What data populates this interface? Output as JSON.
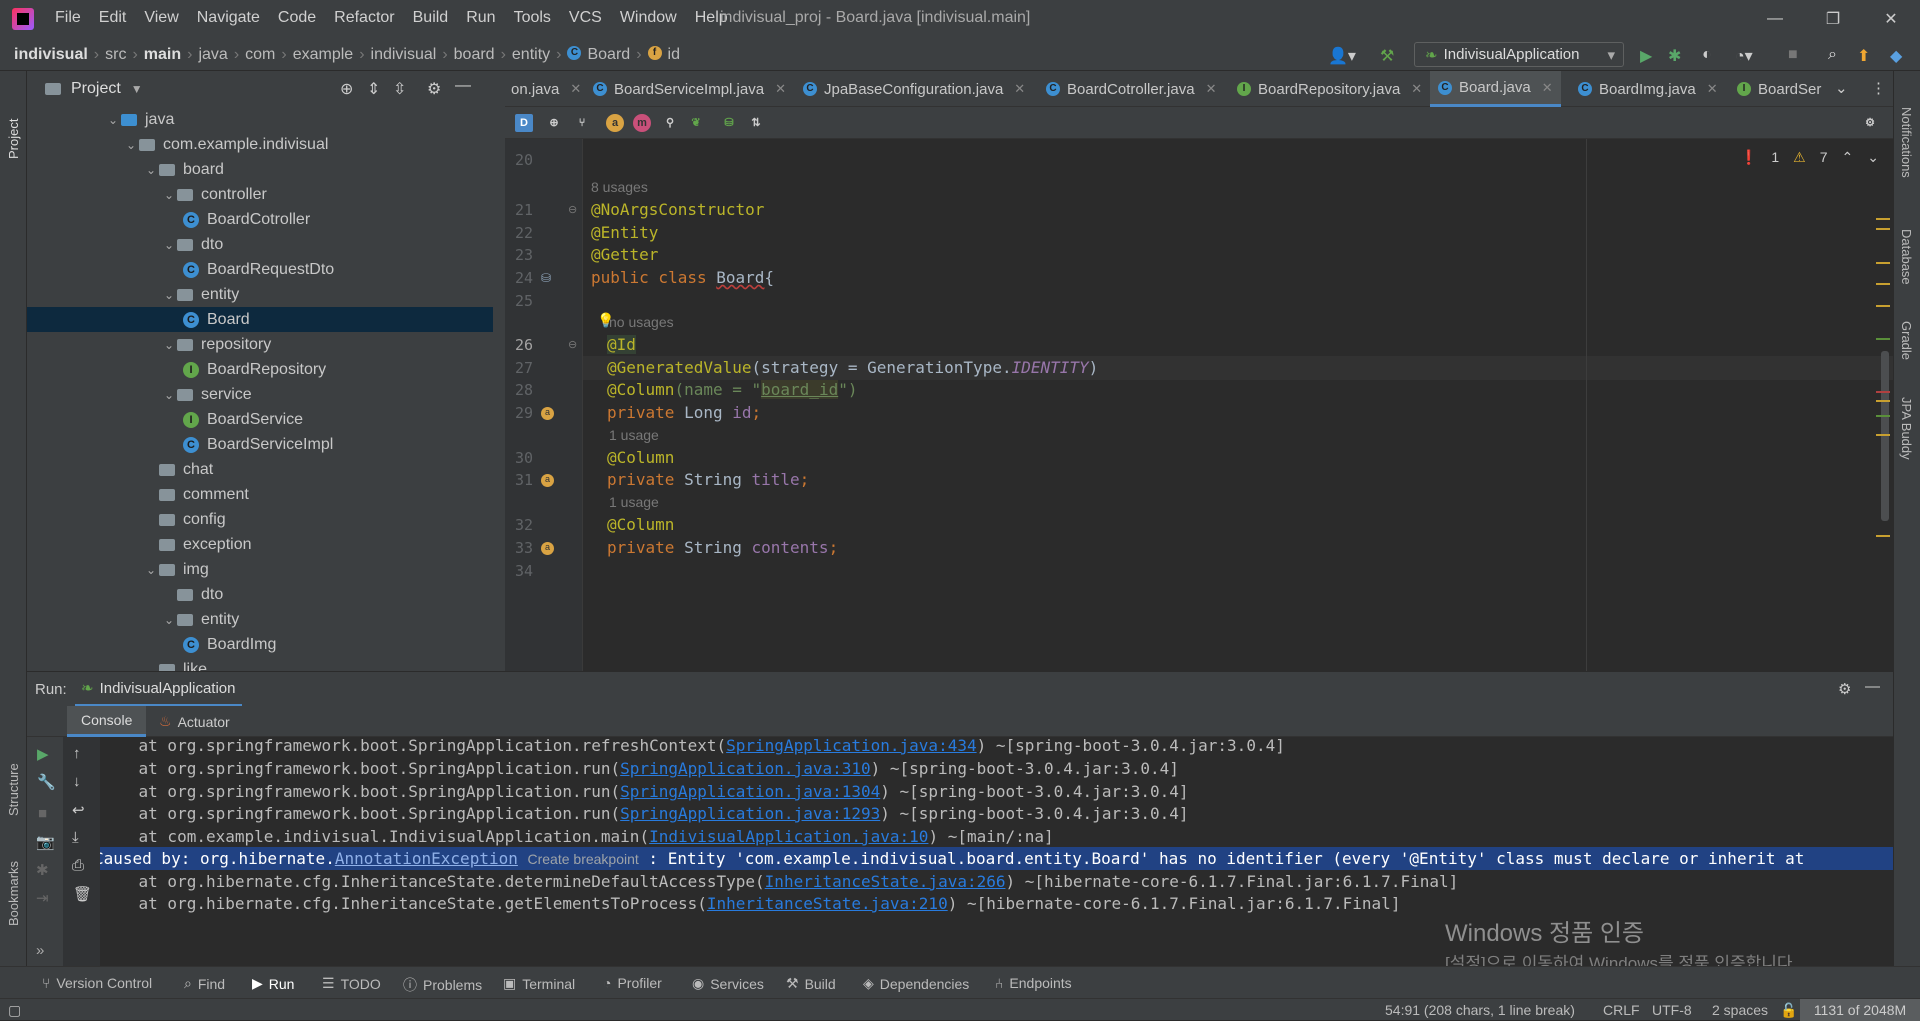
{
  "window": {
    "title": "indivisual_proj - Board.java [indivisual.main]",
    "menu": [
      "File",
      "Edit",
      "View",
      "Navigate",
      "Code",
      "Refactor",
      "Build",
      "Run",
      "Tools",
      "VCS",
      "Window",
      "Help"
    ],
    "controls": [
      "—",
      "❐",
      "✕"
    ]
  },
  "breadcrumbs": [
    "indivisual",
    "src",
    "main",
    "java",
    "com",
    "example",
    "indivisual",
    "board",
    "entity",
    "Board",
    "id"
  ],
  "run_config": "IndivisualApplication",
  "project": {
    "title": "Project",
    "tree": [
      {
        "label": "java",
        "kind": "folder-blue",
        "depth": 0,
        "expanded": true
      },
      {
        "label": "com.example.indivisual",
        "kind": "folder",
        "depth": 1,
        "expanded": true
      },
      {
        "label": "board",
        "kind": "folder",
        "depth": 2,
        "expanded": true
      },
      {
        "label": "controller",
        "kind": "folder",
        "depth": 3,
        "expanded": true
      },
      {
        "label": "BoardCotroller",
        "kind": "class",
        "depth": 4
      },
      {
        "label": "dto",
        "kind": "folder",
        "depth": 3,
        "expanded": true
      },
      {
        "label": "BoardRequestDto",
        "kind": "class",
        "depth": 4
      },
      {
        "label": "entity",
        "kind": "folder",
        "depth": 3,
        "expanded": true
      },
      {
        "label": "Board",
        "kind": "class",
        "depth": 4,
        "selected": true
      },
      {
        "label": "repository",
        "kind": "folder",
        "depth": 3,
        "expanded": true
      },
      {
        "label": "BoardRepository",
        "kind": "interface",
        "depth": 4
      },
      {
        "label": "service",
        "kind": "folder",
        "depth": 3,
        "expanded": true
      },
      {
        "label": "BoardService",
        "kind": "interface",
        "depth": 4
      },
      {
        "label": "BoardServiceImpl",
        "kind": "class",
        "depth": 4
      },
      {
        "label": "chat",
        "kind": "folder",
        "depth": 2
      },
      {
        "label": "comment",
        "kind": "folder",
        "depth": 2
      },
      {
        "label": "config",
        "kind": "folder",
        "depth": 2
      },
      {
        "label": "exception",
        "kind": "folder",
        "depth": 2
      },
      {
        "label": "img",
        "kind": "folder",
        "depth": 2,
        "expanded": true
      },
      {
        "label": "dto",
        "kind": "folder",
        "depth": 3
      },
      {
        "label": "entity",
        "kind": "folder",
        "depth": 3,
        "expanded": true
      },
      {
        "label": "BoardImg",
        "kind": "class",
        "depth": 4
      },
      {
        "label": "like",
        "kind": "folder",
        "depth": 2
      }
    ]
  },
  "editor_tabs": [
    {
      "label": "on.java",
      "icon": "none"
    },
    {
      "label": "BoardServiceImpl.java",
      "icon": "class"
    },
    {
      "label": "JpaBaseConfiguration.java",
      "icon": "class"
    },
    {
      "label": "BoardCotroller.java",
      "icon": "class"
    },
    {
      "label": "BoardRepository.java",
      "icon": "interface"
    },
    {
      "label": "Board.java",
      "icon": "class",
      "active": true
    },
    {
      "label": "BoardImg.java",
      "icon": "class"
    },
    {
      "label": "BoardSer",
      "icon": "interface"
    }
  ],
  "inspections": {
    "errors": "1",
    "warnings": "7"
  },
  "code": {
    "hints": {
      "h1": "8 usages",
      "h2": "no usages",
      "h3": "1 usage",
      "h4": "1 usage"
    },
    "line_numbers": [
      "20",
      "21",
      "22",
      "23",
      "24",
      "25",
      "26",
      "27",
      "28",
      "29",
      "30",
      "31",
      "32",
      "33",
      "34"
    ],
    "l21": "@NoArgsConstructor",
    "l22": "@Entity",
    "l23": "@Getter",
    "l24a": "public class ",
    "l24b": "Board",
    "l24c": "{",
    "l26": "@Id",
    "l27a": "@GeneratedValue",
    "l27b": "(strategy = GenerationType.",
    "l27c": "IDENTITY",
    "l27d": ")",
    "l28a": "@Column",
    "l28b": "(name = \"",
    "l28c": "board_id",
    "l28d": "\")",
    "l29a": "private ",
    "l29b": "Long ",
    "l29c": "id",
    "l29d": ";",
    "l30": "@Column",
    "l31a": "private ",
    "l31b": "String ",
    "l31c": "title",
    "l31d": ";",
    "l32": "@Column",
    "l33a": "private ",
    "l33b": "String ",
    "l33c": "contents",
    "l33d": ";"
  },
  "run": {
    "label": "Run:",
    "tab": "IndivisualApplication",
    "subtabs": [
      "Console",
      "Actuator"
    ],
    "console": [
      {
        "pre": "    at org.springframework.boot.SpringApplication.refreshContext(",
        "link": "SpringApplication.java:434",
        "post": ") ~[spring-boot-3.0.4.jar:3.0.4]"
      },
      {
        "pre": "    at org.springframework.boot.SpringApplication.run(",
        "link": "SpringApplication.java:310",
        "post": ") ~[spring-boot-3.0.4.jar:3.0.4]"
      },
      {
        "pre": "    at org.springframework.boot.SpringApplication.run(",
        "link": "SpringApplication.java:1304",
        "post": ") ~[spring-boot-3.0.4.jar:3.0.4]"
      },
      {
        "pre": "    at org.springframework.boot.SpringApplication.run(",
        "link": "SpringApplication.java:1293",
        "post": ") ~[spring-boot-3.0.4.jar:3.0.4]"
      },
      {
        "pre": "    at com.example.indivisual.IndivisualApplication.main(",
        "link": "IndivisualApplication.java:10",
        "post": ") ~[main/:na]"
      },
      {
        "pre": "    at org.hibernate.cfg.InheritanceState.determineDefaultAccessType(",
        "link": "InheritanceState.java:266",
        "post": ") ~[hibernate-core-6.1.7.Final.jar:6.1.7.Final]"
      },
      {
        "pre": "    at org.hibernate.cfg.InheritanceState.getElementsToProcess(",
        "link": "InheritanceState.java:210",
        "post": ") ~[hibernate-core-6.1.7.Final.jar:6.1.7.Final]"
      }
    ],
    "caused": {
      "pre": "Caused by: org.hibernate.",
      "link": "AnnotationException",
      "breakpoint": "Create breakpoint",
      "post": " : Entity 'com.example.indivisual.board.entity.Board' has no identifier (every '@Entity' class must declare or inherit at"
    }
  },
  "watermark": {
    "title": "Windows 정품 인증",
    "sub": "[설정]으로 이동하여 Windows를 정품 인증합니다."
  },
  "tool_windows": [
    "Version Control",
    "Find",
    "Run",
    "TODO",
    "Problems",
    "Terminal",
    "Profiler",
    "Services",
    "Build",
    "Dependencies",
    "Endpoints"
  ],
  "status": {
    "position": "54:91 (208 chars, 1 line break)",
    "eol": "CRLF",
    "encoding": "UTF-8",
    "indent": "2 spaces",
    "memory": "1131 of 2048M"
  },
  "side_tabs": {
    "left_top": "Project",
    "left_bottom1": "Structure",
    "left_bottom2": "Bookmarks",
    "right": [
      "Notifications",
      "Database",
      "Gradle",
      "JPA Buddy"
    ]
  }
}
